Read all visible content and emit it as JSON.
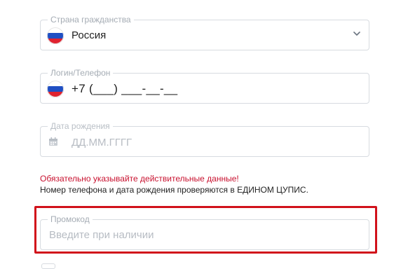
{
  "citizenship": {
    "legend": "Страна гражданства",
    "value": "Россия",
    "flag_icon": "russia-flag-icon",
    "dropdown_icon": "chevron-down-icon"
  },
  "login": {
    "legend": "Логин/Телефон",
    "value": "+7 (___) ___-__-__",
    "flag_icon": "russia-flag-icon"
  },
  "birthdate": {
    "legend": "Дата рождения",
    "placeholder": "ДД.ММ.ГГГГ",
    "icon": "calendar-icon"
  },
  "warning": {
    "text": "Обязательно указывайте действительные данные!",
    "note": "Номер телефона и дата рождения проверяются в ЕДИНОМ ЦУПИС."
  },
  "promo": {
    "legend": "Промокод",
    "placeholder": "Введите при наличии",
    "highlight_color": "#d1121b"
  }
}
